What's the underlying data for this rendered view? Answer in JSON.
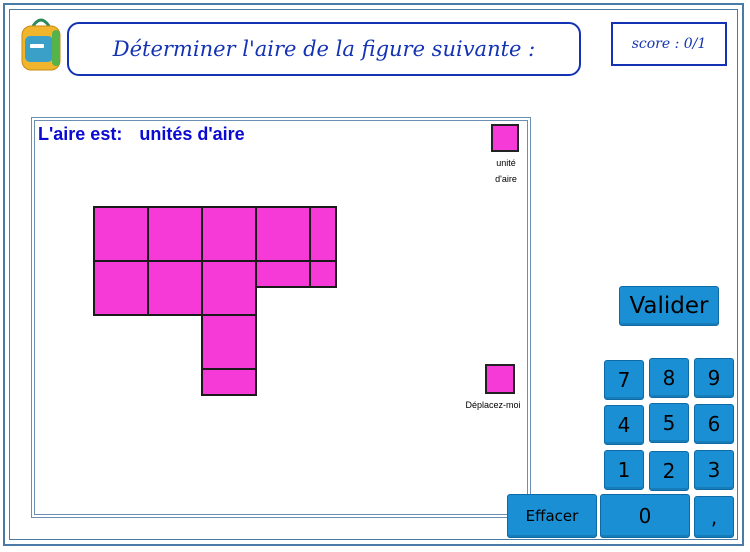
{
  "header": {
    "title": "Déterminer l'aire de la figure suivante :",
    "score": "score : 0/1"
  },
  "workspace": {
    "answer_label": "L'aire est:",
    "answer_unit": "unités d'aire",
    "unit_label_line1": "unité",
    "unit_label_line2": "d'aire",
    "drag_label": "Déplacez-moi"
  },
  "keypad": {
    "validate": "Valider",
    "erase": "Effacer",
    "keys": [
      "7",
      "8",
      "9",
      "4",
      "5",
      "6",
      "1",
      "2",
      "3",
      "0",
      ","
    ]
  },
  "colors": {
    "shape_fill": "#f53ad8",
    "button": "#1b8fd3",
    "title": "#1433b4",
    "answer_text": "#0a0ad2"
  }
}
